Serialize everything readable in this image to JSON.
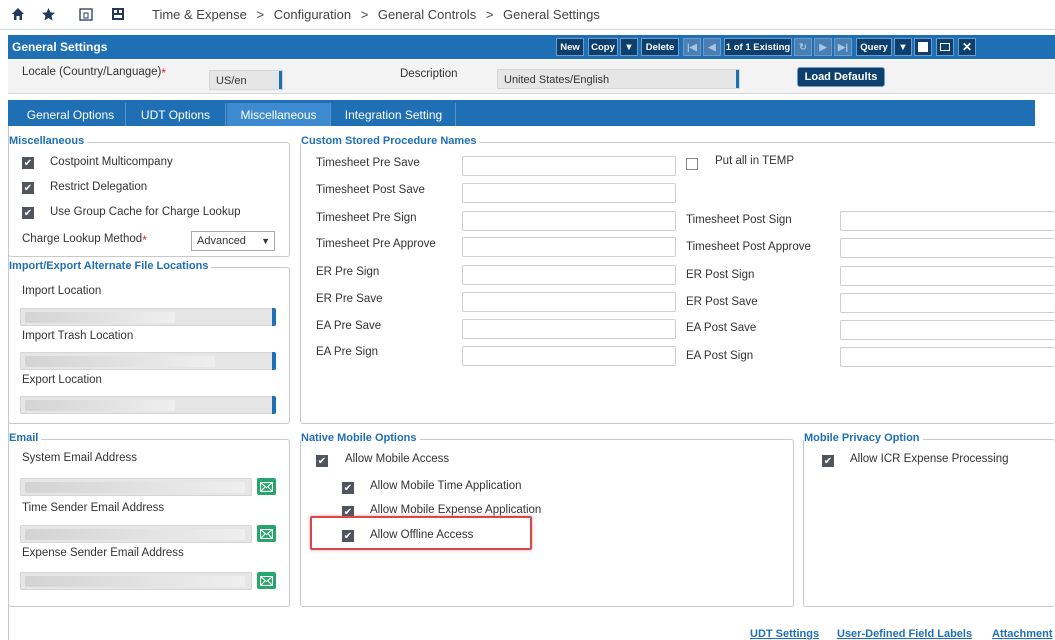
{
  "breadcrumb": {
    "items": [
      "Time & Expense",
      ">",
      "Configuration",
      ">",
      "General Controls",
      ">",
      "General Settings"
    ]
  },
  "titlebar": {
    "title": "General Settings",
    "new_label": "New",
    "copy_label": "Copy",
    "delete_label": "Delete",
    "record_count": "1 of 1 Existing",
    "query_label": "Query"
  },
  "header": {
    "locale_label": "Locale (Country/Language)",
    "locale_value": "US/en",
    "description_label": "Description",
    "description_value": "United States/English",
    "load_defaults_label": "Load Defaults"
  },
  "tabs": [
    {
      "label": "General Options"
    },
    {
      "label": "UDT Options"
    },
    {
      "label": "Miscellaneous",
      "active": true
    },
    {
      "label": "Integration Setting"
    }
  ],
  "miscellaneous": {
    "legend": "Miscellaneous",
    "costpoint_multicompany": "Costpoint Multicompany",
    "restrict_delegation": "Restrict Delegation",
    "group_cache": "Use Group Cache for Charge Lookup",
    "charge_lookup_label": "Charge Lookup Method",
    "charge_lookup_value": "Advanced"
  },
  "import_export": {
    "legend": "Import/Export Alternate File Locations",
    "import_location": "Import Location",
    "import_trash_location": "Import Trash Location",
    "export_location": "Export Location"
  },
  "email": {
    "legend": "Email",
    "system_email": "System Email Address",
    "time_sender_email": "Time Sender Email Address",
    "expense_sender_email": "Expense Sender Email Address"
  },
  "csp": {
    "legend": "Custom Stored Procedure Names",
    "put_all_in_temp": "Put all in TEMP",
    "left": [
      "Timesheet Pre Save",
      "Timesheet Post Save",
      "Timesheet Pre Sign",
      "Timesheet Pre Approve",
      "ER Pre Sign",
      "ER Pre Save",
      "EA Pre Save",
      "EA Pre Sign"
    ],
    "right": [
      "Timesheet Post Sign",
      "Timesheet Post Approve",
      "ER Post Sign",
      "ER Post Save",
      "EA Post Save",
      "EA Post Sign"
    ]
  },
  "native_mobile": {
    "legend": "Native Mobile Options",
    "allow_mobile_access": "Allow Mobile Access",
    "allow_mobile_time": "Allow Mobile Time Application",
    "allow_mobile_expense": "Allow Mobile Expense Application",
    "allow_offline": "Allow Offline Access"
  },
  "mobile_privacy": {
    "legend": "Mobile Privacy Option",
    "allow_icr": "Allow ICR Expense Processing"
  },
  "footer_links": {
    "udt_settings": "UDT Settings",
    "udf_labels": "User-Defined Field Labels",
    "attachment": "Attachment"
  },
  "colors": {
    "brand_blue": "#1f6fb5",
    "dark_navy": "#0d3f6e",
    "highlight_red": "#d6474a",
    "mail_green": "#26a66b"
  }
}
